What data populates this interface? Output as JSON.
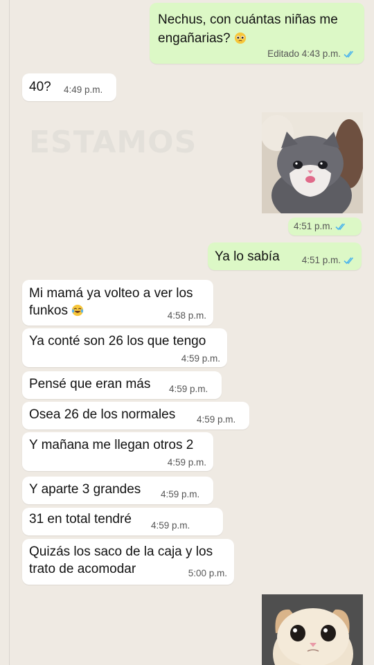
{
  "messages": [
    {
      "id": "m1",
      "direction": "out",
      "lines": [
        "Nechus, con cuántas niñas me",
        "engañarias? 🥺"
      ],
      "meta": "Editado 4:43 p.m.",
      "read": true
    },
    {
      "id": "m2",
      "direction": "in",
      "lines": [
        "40?"
      ],
      "meta": "4:49 p.m."
    },
    {
      "id": "m3",
      "direction": "out",
      "type": "sticker",
      "sticker": "gray-kitten-pouting",
      "meta": "4:51 p.m.",
      "read": true
    },
    {
      "id": "m4",
      "direction": "out",
      "lines": [
        "Ya lo sabía"
      ],
      "meta": "4:51 p.m.",
      "read": true
    },
    {
      "id": "m5",
      "direction": "in",
      "lines": [
        "Mi mamá ya volteo a ver los",
        "funkos 😂"
      ],
      "meta": "4:58 p.m."
    },
    {
      "id": "m6",
      "direction": "in",
      "lines": [
        "Ya conté son 26 los que tengo"
      ],
      "meta": "4:59 p.m."
    },
    {
      "id": "m7",
      "direction": "in",
      "lines": [
        "Pensé que eran más"
      ],
      "meta": "4:59 p.m."
    },
    {
      "id": "m8",
      "direction": "in",
      "lines": [
        "Osea 26 de los normales"
      ],
      "meta": "4:59 p.m."
    },
    {
      "id": "m9",
      "direction": "in",
      "lines": [
        "Y mañana me llegan otros 2"
      ],
      "meta": "4:59 p.m."
    },
    {
      "id": "m10",
      "direction": "in",
      "lines": [
        "Y aparte 3 grandes"
      ],
      "meta": "4:59 p.m."
    },
    {
      "id": "m11",
      "direction": "in",
      "lines": [
        "31 en total tendré"
      ],
      "meta": "4:59 p.m."
    },
    {
      "id": "m12",
      "direction": "in",
      "lines": [
        "Quizás los saco de la caja y los",
        "trato de acomodar"
      ],
      "meta": "5:00 p.m."
    },
    {
      "id": "m13",
      "direction": "out",
      "type": "sticker",
      "sticker": "cream-kitten-sad"
    }
  ],
  "watermark": "ESTAMOS",
  "colors": {
    "chat_bg": "#efeae3",
    "incoming": "#ffffff",
    "outgoing": "#dcf8c6",
    "read_tick": "#4fb6ec"
  }
}
